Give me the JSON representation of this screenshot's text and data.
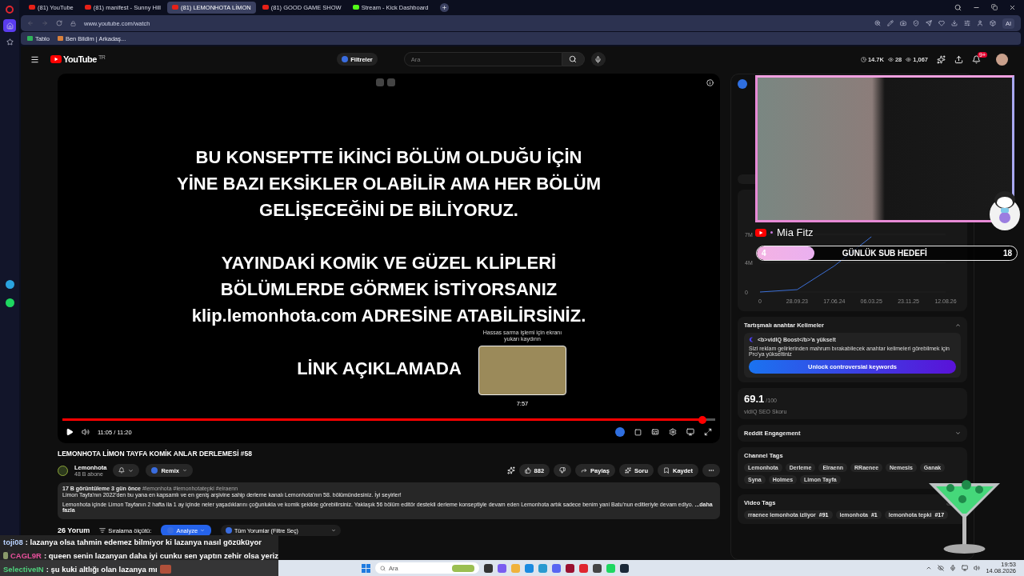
{
  "opera_sidebar": [
    {
      "selected": false
    },
    {
      "selected": true
    },
    {
      "selected": false
    }
  ],
  "browser": {
    "tabs": [
      {
        "title": "(81) YouTube",
        "selected": false,
        "kind": "youtube"
      },
      {
        "title": "(81) manifest - Sunny Hill",
        "selected": false,
        "kind": "youtube"
      },
      {
        "title": "(81) LEMONHOTA LİMON",
        "selected": true,
        "kind": "youtube"
      },
      {
        "title": "(81) GOOD GAME SHOW",
        "selected": false,
        "kind": "youtube"
      },
      {
        "title": "Stream - Kick Dashboard",
        "selected": false,
        "kind": "kick"
      }
    ],
    "url": "www.youtube.com/watch",
    "ai_button": "AI",
    "bookmarks": [
      "Tablo",
      "Ben Bildim | Arkadaş..."
    ]
  },
  "header": {
    "logo": "YouTube",
    "region": "TR",
    "filter_button": "Filtreler",
    "search_placeholder": "Ara",
    "stats": [
      "14.7K",
      "28",
      "1,067"
    ],
    "notification_badge": "9+"
  },
  "video": {
    "paragraphs": [
      [
        "BU KONSEPTTE İKİNCİ BÖLÜM OLDUĞU İÇİN",
        "YİNE BAZI EKSİKLER OLABİLİR AMA HER BÖLÜM",
        "GELİŞECEĞİNİ DE BİLİYORUZ."
      ],
      [
        "YAYINDAKİ KOMİK VE GÜZEL KLİPLERİ",
        "BÖLÜMLERDE GÖRMEK İSTİYORSANIZ",
        "klip.lemonhota.com ADRESİNE ATABİLİRSİNİZ."
      ],
      [
        "LİNK AÇIKLAMADA"
      ]
    ],
    "time": "11:05 / 11:20",
    "level": 0.98,
    "preview": {
      "hint": "Hassas sarma işlemi için ekranı yukarı kaydırın",
      "time": "7:57"
    }
  },
  "details": {
    "title": "LEMONHOTA LİMON TAYFA KOMİK ANLAR DERLEMESİ #58",
    "channel": "Lemonhota",
    "subscribers": "48 B abone",
    "remix": "Remix",
    "likes": "882",
    "share": "Paylaş",
    "ask": "Soru",
    "save": "Kaydet",
    "meta": "17 B görüntüleme  3 gün önce",
    "hashtags": "#lemonhota #lemonhotatepki #elraenn",
    "description": [
      "Limon Tayfa'nın 2022'den bu yana en kapsamlı ve en geniş arşivine sahip derleme kanalı Lemonhota'nın 58. bölümündesiniz. İyi seyirler!",
      "Lemonhota içinde Limon Tayfanın 2 hafta ila 1 ay içinde neler yaşadıklarını çoğunlukla ve komik şekilde görebilirsiniz. Yaklaşık 56 bölüm editör destekli derleme konseptiyle devam eden Lemonhota artık sadece benim yani Batu'nun editleriyle devam ediyo."
    ],
    "more": "...daha fazla"
  },
  "comments": {
    "count": "26 Yorum",
    "sort": "Sıralama ölçütü:",
    "analyze": "Analyze",
    "filter": "Tüm Yorumlar (Filtre Seç)"
  },
  "vidiq": {
    "chart_data": {
      "type": "line",
      "categories": [
        "0",
        "28.09.23",
        "17.06.24",
        "06.03.25",
        "23.11.25",
        "12.08.26"
      ],
      "series": [
        {
          "color": "#3b6fd6",
          "values": [
            0,
            0.3,
            3.3,
            7.0,
            null,
            null
          ]
        }
      ],
      "ylim": [
        0,
        7.3
      ],
      "yticks": [
        {
          "value": 0,
          "label": "0"
        },
        {
          "value": 3.7,
          "label": "4M"
        },
        {
          "value": 7.3,
          "label": "7M"
        }
      ]
    },
    "keywords": {
      "title": "Tartışmalı anahtar Kelimeler",
      "upgrade": "<b>vidIQ Boost</b>'a yükselt",
      "text": "Sizi reklam gelirlerinden mahrum bırakabilecek anahtar kelimeleri görebilmek için Pro'ya yükseltiniz",
      "button": "Unlock controversial keywords"
    },
    "seo": {
      "score": "69.1",
      "max": "/100",
      "label": "vidIQ SEO Skoru"
    },
    "reddit": "Reddit Engagement",
    "channel_tags": {
      "title": "Channel Tags",
      "tags": [
        "Lemonhota",
        "Derleme",
        "Elraenn",
        "RRaenee",
        "Nemesis",
        "Ganak",
        "Syna",
        "Holmes",
        "Limon Tayfa"
      ]
    },
    "video_tags": {
      "title": "Video Tags",
      "tags": [
        {
          "name": "rraenee lemonhota izliyor",
          "rank": "#91"
        },
        {
          "name": "lemonhota",
          "rank": "#1"
        },
        {
          "name": "lemonhota tepki",
          "rank": "#17"
        }
      ]
    }
  },
  "stream_overlay": {
    "streamer": "Mia Fitz",
    "goal": {
      "current": "4",
      "label": "GÜNLÜK SUB HEDEFİ",
      "target": "18",
      "level": 0.22
    }
  },
  "chat": [
    {
      "user": "toji08",
      "color": "#b9d2ff",
      "badge": false,
      "emote": false,
      "message": ": lazanya olsa tahmin edemez bilmiyor ki lazanya nasıl gözüküyor"
    },
    {
      "user": "CAGL9R",
      "color": "#e8509c",
      "badge": true,
      "emote": false,
      "message": ": queen senin lazanyan daha iyi cunku sen yaptın zehir olsa yeriz"
    },
    {
      "user": "SelectiveIN",
      "color": "#4fd07c",
      "badge": false,
      "emote": true,
      "message": ": şu kuki altlığı olan lazanya mı"
    }
  ],
  "taskbar": {
    "search_placeholder": "Ara",
    "time": "19:53",
    "date": "14.08.2026"
  }
}
